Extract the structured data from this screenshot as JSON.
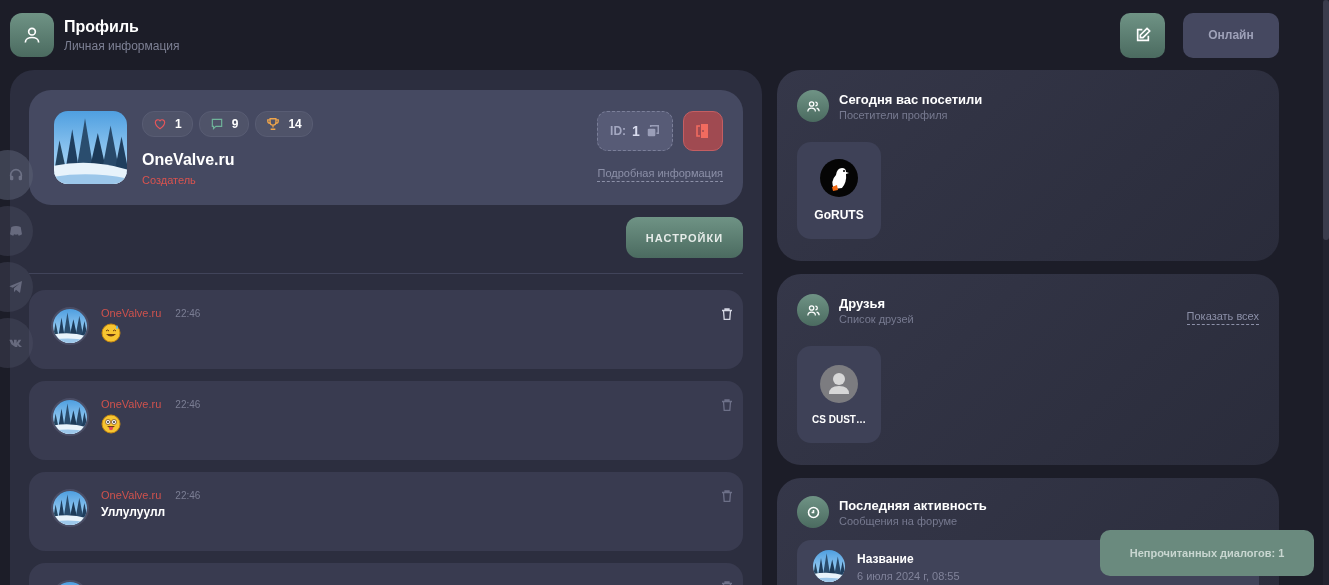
{
  "header": {
    "title": "Профиль",
    "subtitle": "Личная информация",
    "status_button": "Онлайн"
  },
  "social_links": [
    {
      "kind": "headset"
    },
    {
      "kind": "discord"
    },
    {
      "kind": "telegram"
    },
    {
      "kind": "vk"
    }
  ],
  "profile": {
    "stats": [
      {
        "kind": "likes",
        "value": "1"
      },
      {
        "kind": "comments",
        "value": "9"
      },
      {
        "kind": "trophies",
        "value": "14"
      }
    ],
    "name": "OneValve.ru",
    "role": "Создатель",
    "id_label": "ID:",
    "id_value": "1",
    "details_link": "Подробная информация",
    "settings_button": "НАСТРОЙКИ"
  },
  "messages": [
    {
      "author": "OneValve.ru",
      "time": "22:46",
      "kind": "sweat_smile"
    },
    {
      "author": "OneValve.ru",
      "time": "22:46",
      "kind": "goofy"
    },
    {
      "author": "OneValve.ru",
      "time": "22:46",
      "kind": "text",
      "text": "Уллулуулл"
    },
    {
      "kind": "cut"
    }
  ],
  "visitors": {
    "title": "Сегодня вас посетили",
    "subtitle": "Посетители профиля",
    "users": [
      {
        "name": "GoRUTS",
        "kind": "bird"
      }
    ]
  },
  "friends": {
    "title": "Друзья",
    "subtitle": "Список друзей",
    "show_all": "Показать всех",
    "users": [
      {
        "name": "CS DUST…",
        "kind": "default"
      }
    ]
  },
  "activity": {
    "title": "Последняя активность",
    "subtitle": "Сообщения на форуме",
    "items": [
      {
        "title": "Название",
        "date": "6 июля 2024 г, 08:55"
      }
    ]
  },
  "toast": "Непрочитанных диалогов: 1"
}
